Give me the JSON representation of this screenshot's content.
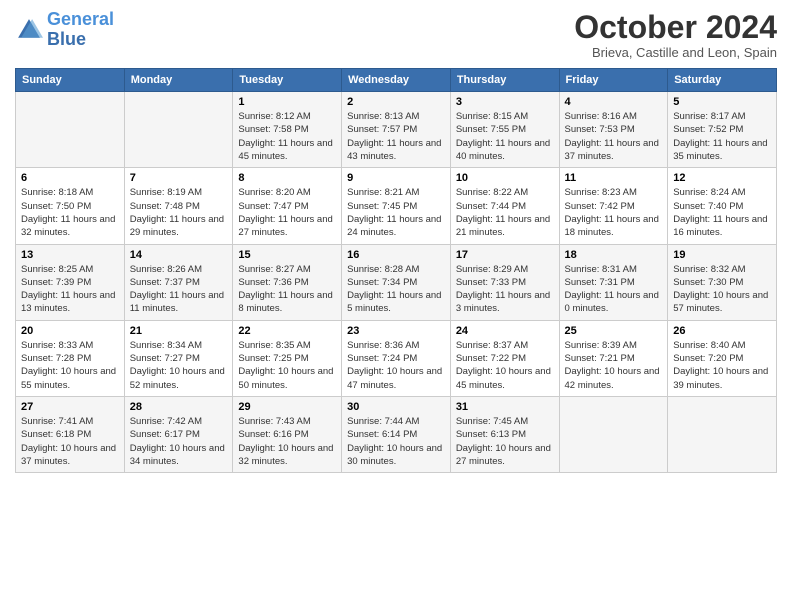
{
  "header": {
    "logo_line1": "General",
    "logo_line2": "Blue",
    "title": "October 2024",
    "subtitle": "Brieva, Castille and Leon, Spain"
  },
  "weekdays": [
    "Sunday",
    "Monday",
    "Tuesday",
    "Wednesday",
    "Thursday",
    "Friday",
    "Saturday"
  ],
  "weeks": [
    [
      {
        "day": "",
        "info": ""
      },
      {
        "day": "",
        "info": ""
      },
      {
        "day": "1",
        "info": "Sunrise: 8:12 AM\nSunset: 7:58 PM\nDaylight: 11 hours and 45 minutes."
      },
      {
        "day": "2",
        "info": "Sunrise: 8:13 AM\nSunset: 7:57 PM\nDaylight: 11 hours and 43 minutes."
      },
      {
        "day": "3",
        "info": "Sunrise: 8:15 AM\nSunset: 7:55 PM\nDaylight: 11 hours and 40 minutes."
      },
      {
        "day": "4",
        "info": "Sunrise: 8:16 AM\nSunset: 7:53 PM\nDaylight: 11 hours and 37 minutes."
      },
      {
        "day": "5",
        "info": "Sunrise: 8:17 AM\nSunset: 7:52 PM\nDaylight: 11 hours and 35 minutes."
      }
    ],
    [
      {
        "day": "6",
        "info": "Sunrise: 8:18 AM\nSunset: 7:50 PM\nDaylight: 11 hours and 32 minutes."
      },
      {
        "day": "7",
        "info": "Sunrise: 8:19 AM\nSunset: 7:48 PM\nDaylight: 11 hours and 29 minutes."
      },
      {
        "day": "8",
        "info": "Sunrise: 8:20 AM\nSunset: 7:47 PM\nDaylight: 11 hours and 27 minutes."
      },
      {
        "day": "9",
        "info": "Sunrise: 8:21 AM\nSunset: 7:45 PM\nDaylight: 11 hours and 24 minutes."
      },
      {
        "day": "10",
        "info": "Sunrise: 8:22 AM\nSunset: 7:44 PM\nDaylight: 11 hours and 21 minutes."
      },
      {
        "day": "11",
        "info": "Sunrise: 8:23 AM\nSunset: 7:42 PM\nDaylight: 11 hours and 18 minutes."
      },
      {
        "day": "12",
        "info": "Sunrise: 8:24 AM\nSunset: 7:40 PM\nDaylight: 11 hours and 16 minutes."
      }
    ],
    [
      {
        "day": "13",
        "info": "Sunrise: 8:25 AM\nSunset: 7:39 PM\nDaylight: 11 hours and 13 minutes."
      },
      {
        "day": "14",
        "info": "Sunrise: 8:26 AM\nSunset: 7:37 PM\nDaylight: 11 hours and 11 minutes."
      },
      {
        "day": "15",
        "info": "Sunrise: 8:27 AM\nSunset: 7:36 PM\nDaylight: 11 hours and 8 minutes."
      },
      {
        "day": "16",
        "info": "Sunrise: 8:28 AM\nSunset: 7:34 PM\nDaylight: 11 hours and 5 minutes."
      },
      {
        "day": "17",
        "info": "Sunrise: 8:29 AM\nSunset: 7:33 PM\nDaylight: 11 hours and 3 minutes."
      },
      {
        "day": "18",
        "info": "Sunrise: 8:31 AM\nSunset: 7:31 PM\nDaylight: 11 hours and 0 minutes."
      },
      {
        "day": "19",
        "info": "Sunrise: 8:32 AM\nSunset: 7:30 PM\nDaylight: 10 hours and 57 minutes."
      }
    ],
    [
      {
        "day": "20",
        "info": "Sunrise: 8:33 AM\nSunset: 7:28 PM\nDaylight: 10 hours and 55 minutes."
      },
      {
        "day": "21",
        "info": "Sunrise: 8:34 AM\nSunset: 7:27 PM\nDaylight: 10 hours and 52 minutes."
      },
      {
        "day": "22",
        "info": "Sunrise: 8:35 AM\nSunset: 7:25 PM\nDaylight: 10 hours and 50 minutes."
      },
      {
        "day": "23",
        "info": "Sunrise: 8:36 AM\nSunset: 7:24 PM\nDaylight: 10 hours and 47 minutes."
      },
      {
        "day": "24",
        "info": "Sunrise: 8:37 AM\nSunset: 7:22 PM\nDaylight: 10 hours and 45 minutes."
      },
      {
        "day": "25",
        "info": "Sunrise: 8:39 AM\nSunset: 7:21 PM\nDaylight: 10 hours and 42 minutes."
      },
      {
        "day": "26",
        "info": "Sunrise: 8:40 AM\nSunset: 7:20 PM\nDaylight: 10 hours and 39 minutes."
      }
    ],
    [
      {
        "day": "27",
        "info": "Sunrise: 7:41 AM\nSunset: 6:18 PM\nDaylight: 10 hours and 37 minutes."
      },
      {
        "day": "28",
        "info": "Sunrise: 7:42 AM\nSunset: 6:17 PM\nDaylight: 10 hours and 34 minutes."
      },
      {
        "day": "29",
        "info": "Sunrise: 7:43 AM\nSunset: 6:16 PM\nDaylight: 10 hours and 32 minutes."
      },
      {
        "day": "30",
        "info": "Sunrise: 7:44 AM\nSunset: 6:14 PM\nDaylight: 10 hours and 30 minutes."
      },
      {
        "day": "31",
        "info": "Sunrise: 7:45 AM\nSunset: 6:13 PM\nDaylight: 10 hours and 27 minutes."
      },
      {
        "day": "",
        "info": ""
      },
      {
        "day": "",
        "info": ""
      }
    ]
  ]
}
